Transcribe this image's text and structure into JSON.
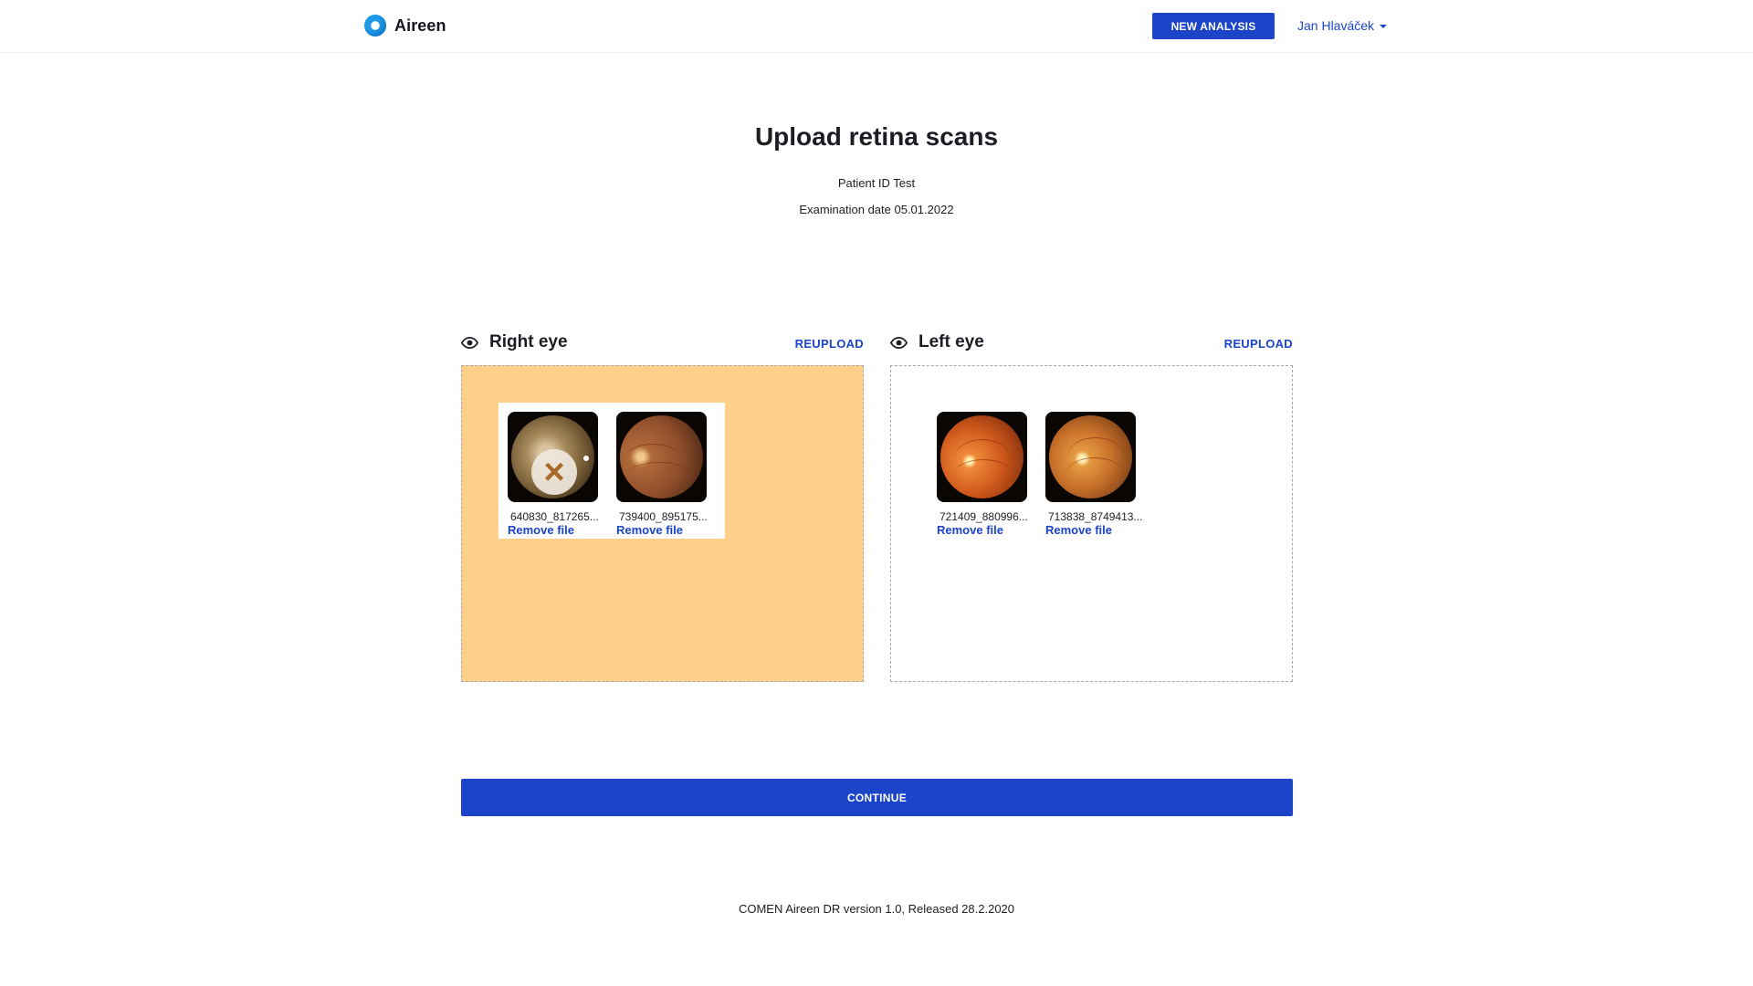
{
  "header": {
    "brand_name": "Aireen",
    "new_analysis_label": "NEW ANALYSIS",
    "user_name": "Jan Hlaváček"
  },
  "main": {
    "title": "Upload retina scans",
    "patient_line": "Patient ID Test",
    "exam_line": "Examination date 05.01.2022",
    "continue_label": "CONTINUE"
  },
  "eyes": {
    "right": {
      "title": "Right eye",
      "reupload_label": "REUPLOAD",
      "files": [
        {
          "name": "640830_817265...",
          "remove_label": "Remove file"
        },
        {
          "name": "739400_895175...",
          "remove_label": "Remove file"
        }
      ]
    },
    "left": {
      "title": "Left eye",
      "reupload_label": "REUPLOAD",
      "files": [
        {
          "name": "721409_880996...",
          "remove_label": "Remove file"
        },
        {
          "name": "713838_8749413...",
          "remove_label": "Remove file"
        }
      ]
    }
  },
  "footer": {
    "text": "COMEN Aireen DR version 1.0, Released 28.2.2020"
  },
  "colors": {
    "accent": "#1c44c9",
    "dropzone_active": "#ffd089"
  },
  "icons": {
    "brand": "aireen-logo-icon",
    "eye": "eye-icon",
    "caret": "caret-down-icon",
    "remove_overlay": "close-icon"
  }
}
